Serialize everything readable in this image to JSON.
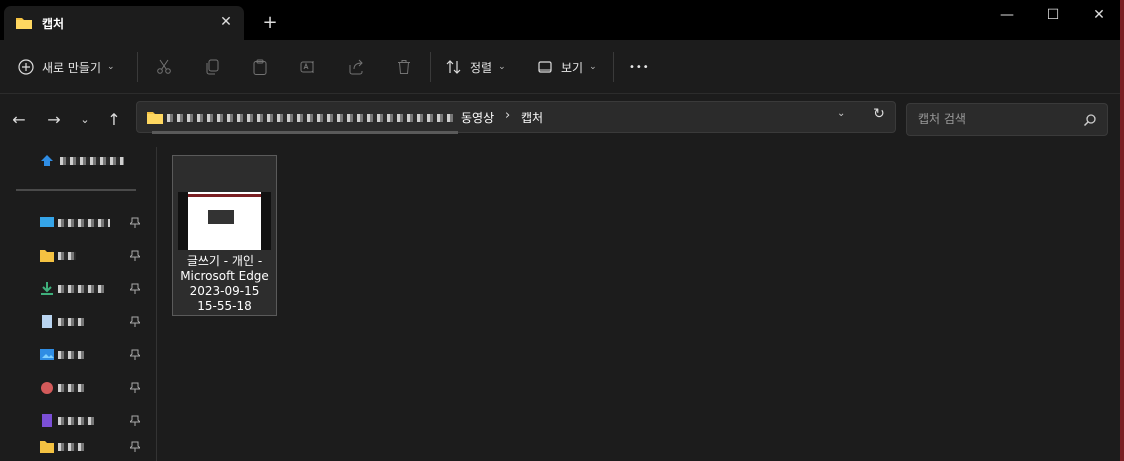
{
  "window": {
    "tab_title": "캡처",
    "new_tab_label": "+",
    "minimize": "—",
    "maximize": "☐",
    "close": "✕"
  },
  "toolbar": {
    "new_label": "새로 만들기",
    "sort_label": "정렬",
    "view_label": "보기",
    "more_label": "•••"
  },
  "address": {
    "crumbs": [
      "동영상",
      "캡처"
    ],
    "search_placeholder": "캡처 검색"
  },
  "files": [
    {
      "name": "글쓰기 - 개인 -\nMicrosoft Edge\n2023-09-15\n15-55-18"
    }
  ],
  "colors": {
    "accent_folder": "#f4c242",
    "background": "#1c1c1c",
    "titlebar": "#000000"
  }
}
